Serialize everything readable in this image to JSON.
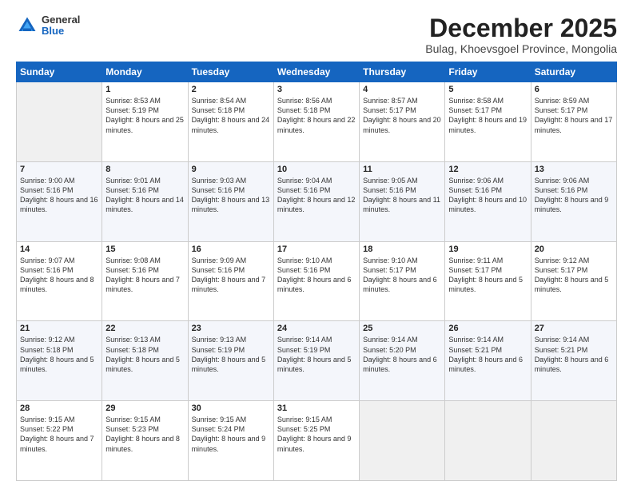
{
  "header": {
    "logo_general": "General",
    "logo_blue": "Blue",
    "month_title": "December 2025",
    "subtitle": "Bulag, Khoevsgoel Province, Mongolia"
  },
  "days_of_week": [
    "Sunday",
    "Monday",
    "Tuesday",
    "Wednesday",
    "Thursday",
    "Friday",
    "Saturday"
  ],
  "weeks": [
    [
      {
        "num": "",
        "sunrise": "",
        "sunset": "",
        "daylight": ""
      },
      {
        "num": "1",
        "sunrise": "Sunrise: 8:53 AM",
        "sunset": "Sunset: 5:19 PM",
        "daylight": "Daylight: 8 hours and 25 minutes."
      },
      {
        "num": "2",
        "sunrise": "Sunrise: 8:54 AM",
        "sunset": "Sunset: 5:18 PM",
        "daylight": "Daylight: 8 hours and 24 minutes."
      },
      {
        "num": "3",
        "sunrise": "Sunrise: 8:56 AM",
        "sunset": "Sunset: 5:18 PM",
        "daylight": "Daylight: 8 hours and 22 minutes."
      },
      {
        "num": "4",
        "sunrise": "Sunrise: 8:57 AM",
        "sunset": "Sunset: 5:17 PM",
        "daylight": "Daylight: 8 hours and 20 minutes."
      },
      {
        "num": "5",
        "sunrise": "Sunrise: 8:58 AM",
        "sunset": "Sunset: 5:17 PM",
        "daylight": "Daylight: 8 hours and 19 minutes."
      },
      {
        "num": "6",
        "sunrise": "Sunrise: 8:59 AM",
        "sunset": "Sunset: 5:17 PM",
        "daylight": "Daylight: 8 hours and 17 minutes."
      }
    ],
    [
      {
        "num": "7",
        "sunrise": "Sunrise: 9:00 AM",
        "sunset": "Sunset: 5:16 PM",
        "daylight": "Daylight: 8 hours and 16 minutes."
      },
      {
        "num": "8",
        "sunrise": "Sunrise: 9:01 AM",
        "sunset": "Sunset: 5:16 PM",
        "daylight": "Daylight: 8 hours and 14 minutes."
      },
      {
        "num": "9",
        "sunrise": "Sunrise: 9:03 AM",
        "sunset": "Sunset: 5:16 PM",
        "daylight": "Daylight: 8 hours and 13 minutes."
      },
      {
        "num": "10",
        "sunrise": "Sunrise: 9:04 AM",
        "sunset": "Sunset: 5:16 PM",
        "daylight": "Daylight: 8 hours and 12 minutes."
      },
      {
        "num": "11",
        "sunrise": "Sunrise: 9:05 AM",
        "sunset": "Sunset: 5:16 PM",
        "daylight": "Daylight: 8 hours and 11 minutes."
      },
      {
        "num": "12",
        "sunrise": "Sunrise: 9:06 AM",
        "sunset": "Sunset: 5:16 PM",
        "daylight": "Daylight: 8 hours and 10 minutes."
      },
      {
        "num": "13",
        "sunrise": "Sunrise: 9:06 AM",
        "sunset": "Sunset: 5:16 PM",
        "daylight": "Daylight: 8 hours and 9 minutes."
      }
    ],
    [
      {
        "num": "14",
        "sunrise": "Sunrise: 9:07 AM",
        "sunset": "Sunset: 5:16 PM",
        "daylight": "Daylight: 8 hours and 8 minutes."
      },
      {
        "num": "15",
        "sunrise": "Sunrise: 9:08 AM",
        "sunset": "Sunset: 5:16 PM",
        "daylight": "Daylight: 8 hours and 7 minutes."
      },
      {
        "num": "16",
        "sunrise": "Sunrise: 9:09 AM",
        "sunset": "Sunset: 5:16 PM",
        "daylight": "Daylight: 8 hours and 7 minutes."
      },
      {
        "num": "17",
        "sunrise": "Sunrise: 9:10 AM",
        "sunset": "Sunset: 5:16 PM",
        "daylight": "Daylight: 8 hours and 6 minutes."
      },
      {
        "num": "18",
        "sunrise": "Sunrise: 9:10 AM",
        "sunset": "Sunset: 5:17 PM",
        "daylight": "Daylight: 8 hours and 6 minutes."
      },
      {
        "num": "19",
        "sunrise": "Sunrise: 9:11 AM",
        "sunset": "Sunset: 5:17 PM",
        "daylight": "Daylight: 8 hours and 5 minutes."
      },
      {
        "num": "20",
        "sunrise": "Sunrise: 9:12 AM",
        "sunset": "Sunset: 5:17 PM",
        "daylight": "Daylight: 8 hours and 5 minutes."
      }
    ],
    [
      {
        "num": "21",
        "sunrise": "Sunrise: 9:12 AM",
        "sunset": "Sunset: 5:18 PM",
        "daylight": "Daylight: 8 hours and 5 minutes."
      },
      {
        "num": "22",
        "sunrise": "Sunrise: 9:13 AM",
        "sunset": "Sunset: 5:18 PM",
        "daylight": "Daylight: 8 hours and 5 minutes."
      },
      {
        "num": "23",
        "sunrise": "Sunrise: 9:13 AM",
        "sunset": "Sunset: 5:19 PM",
        "daylight": "Daylight: 8 hours and 5 minutes."
      },
      {
        "num": "24",
        "sunrise": "Sunrise: 9:14 AM",
        "sunset": "Sunset: 5:19 PM",
        "daylight": "Daylight: 8 hours and 5 minutes."
      },
      {
        "num": "25",
        "sunrise": "Sunrise: 9:14 AM",
        "sunset": "Sunset: 5:20 PM",
        "daylight": "Daylight: 8 hours and 6 minutes."
      },
      {
        "num": "26",
        "sunrise": "Sunrise: 9:14 AM",
        "sunset": "Sunset: 5:21 PM",
        "daylight": "Daylight: 8 hours and 6 minutes."
      },
      {
        "num": "27",
        "sunrise": "Sunrise: 9:14 AM",
        "sunset": "Sunset: 5:21 PM",
        "daylight": "Daylight: 8 hours and 6 minutes."
      }
    ],
    [
      {
        "num": "28",
        "sunrise": "Sunrise: 9:15 AM",
        "sunset": "Sunset: 5:22 PM",
        "daylight": "Daylight: 8 hours and 7 minutes."
      },
      {
        "num": "29",
        "sunrise": "Sunrise: 9:15 AM",
        "sunset": "Sunset: 5:23 PM",
        "daylight": "Daylight: 8 hours and 8 minutes."
      },
      {
        "num": "30",
        "sunrise": "Sunrise: 9:15 AM",
        "sunset": "Sunset: 5:24 PM",
        "daylight": "Daylight: 8 hours and 9 minutes."
      },
      {
        "num": "31",
        "sunrise": "Sunrise: 9:15 AM",
        "sunset": "Sunset: 5:25 PM",
        "daylight": "Daylight: 8 hours and 9 minutes."
      },
      {
        "num": "",
        "sunrise": "",
        "sunset": "",
        "daylight": ""
      },
      {
        "num": "",
        "sunrise": "",
        "sunset": "",
        "daylight": ""
      },
      {
        "num": "",
        "sunrise": "",
        "sunset": "",
        "daylight": ""
      }
    ]
  ]
}
